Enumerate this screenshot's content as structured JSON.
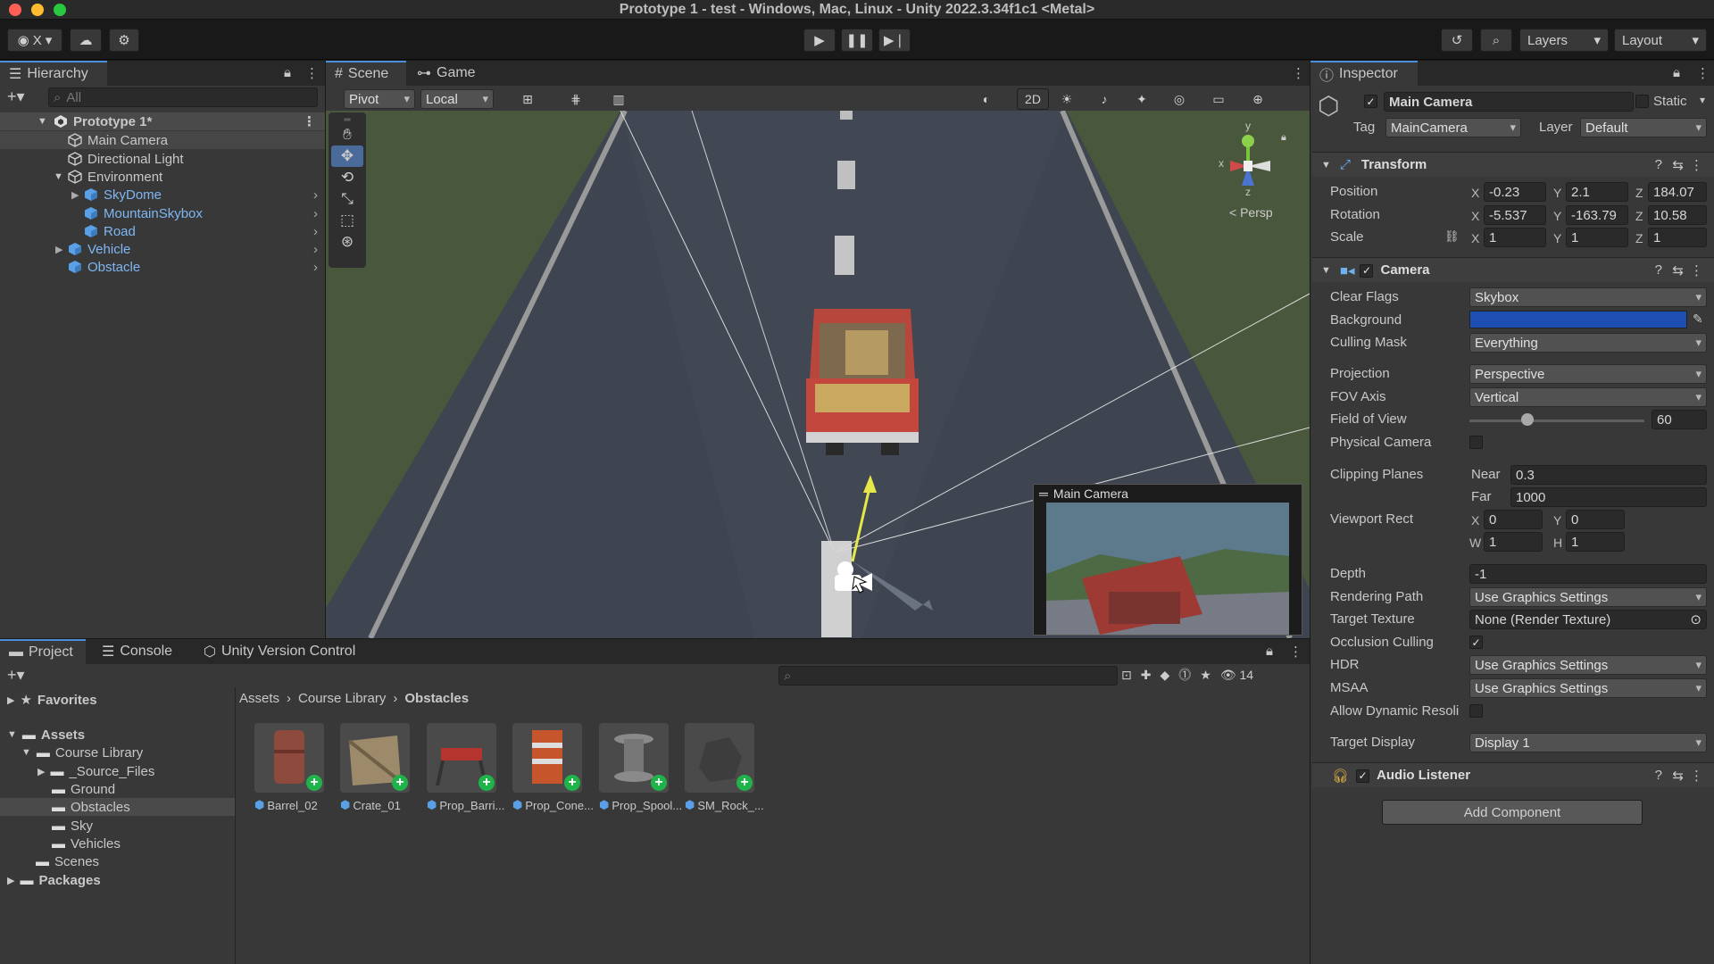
{
  "window": {
    "title": "Prototype 1 - test - Windows, Mac, Linux - Unity 2022.3.34f1c1 <Metal>"
  },
  "toolbar": {
    "account": "X",
    "layers": "Layers",
    "layout": "Layout"
  },
  "hierarchy": {
    "tab": "Hierarchy",
    "search_placeholder": "All",
    "scene": "Prototype 1*",
    "items": [
      "Main Camera",
      "Directional Light",
      "Environment",
      "SkyDome",
      "MountainSkybox",
      "Road",
      "Vehicle",
      "Obstacle"
    ]
  },
  "scene_view": {
    "tabs": [
      "Scene",
      "Game"
    ],
    "pivot": "Pivot",
    "local": "Local",
    "mode_2d": "2D",
    "persp": "< Persp",
    "gizmo_axes": {
      "x": "x",
      "y": "y",
      "z": "z"
    },
    "preview_title": "Main Camera"
  },
  "project": {
    "tabs": [
      "Project",
      "Console",
      "Unity Version Control"
    ],
    "favorites": "Favorites",
    "assets": "Assets",
    "tree": [
      "Course Library",
      "_Source_Files",
      "Ground",
      "Obstacles",
      "Sky",
      "Vehicles",
      "Scenes"
    ],
    "packages": "Packages",
    "breadcrumb": [
      "Assets",
      "Course Library",
      "Obstacles"
    ],
    "count": "14",
    "items": [
      "Barrel_02",
      "Crate_01",
      "Prop_Barri...",
      "Prop_Cone...",
      "Prop_Spool...",
      "SM_Rock_..."
    ]
  },
  "inspector": {
    "tab": "Inspector",
    "object_name": "Main Camera",
    "static_label": "Static",
    "tag_label": "Tag",
    "tag": "MainCamera",
    "layer_label": "Layer",
    "layer": "Default",
    "transform": {
      "title": "Transform",
      "position": {
        "label": "Position",
        "x": "-0.23",
        "y": "2.1",
        "z": "184.07"
      },
      "rotation": {
        "label": "Rotation",
        "x": "-5.537",
        "y": "-163.79",
        "z": "10.58"
      },
      "scale": {
        "label": "Scale",
        "x": "1",
        "y": "1",
        "z": "1"
      }
    },
    "camera": {
      "title": "Camera",
      "clear_flags": {
        "label": "Clear Flags",
        "value": "Skybox"
      },
      "background": {
        "label": "Background",
        "color": "#1d4fb3"
      },
      "culling_mask": {
        "label": "Culling Mask",
        "value": "Everything"
      },
      "projection": {
        "label": "Projection",
        "value": "Perspective"
      },
      "fov_axis": {
        "label": "FOV Axis",
        "value": "Vertical"
      },
      "fov": {
        "label": "Field of View",
        "value": "60",
        "slider_fraction": 0.33
      },
      "physical": {
        "label": "Physical Camera"
      },
      "clipping": {
        "label": "Clipping Planes",
        "near_label": "Near",
        "near": "0.3",
        "far_label": "Far",
        "far": "1000"
      },
      "viewport": {
        "label": "Viewport Rect",
        "x": "0",
        "y": "0",
        "w": "1",
        "h": "1"
      },
      "depth": {
        "label": "Depth",
        "value": "-1"
      },
      "rendering_path": {
        "label": "Rendering Path",
        "value": "Use Graphics Settings"
      },
      "target_texture": {
        "label": "Target Texture",
        "value": "None (Render Texture)"
      },
      "occlusion": {
        "label": "Occlusion Culling"
      },
      "hdr": {
        "label": "HDR",
        "value": "Use Graphics Settings"
      },
      "msaa": {
        "label": "MSAA",
        "value": "Use Graphics Settings"
      },
      "dynamic_res": {
        "label": "Allow Dynamic Resoli"
      },
      "target_display": {
        "label": "Target Display",
        "value": "Display 1"
      }
    },
    "audio": {
      "title": "Audio Listener"
    },
    "add_component": "Add Component"
  }
}
